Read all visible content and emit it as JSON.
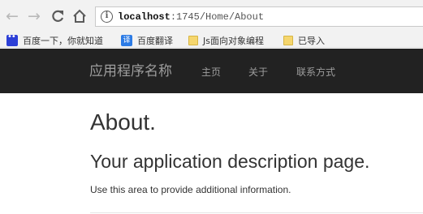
{
  "browser": {
    "url_host": "localhost",
    "url_path": ":1745/Home/About",
    "back_icon": "arrow-left-icon",
    "forward_icon": "arrow-right-icon",
    "reload_icon": "reload-icon",
    "home_icon": "home-icon",
    "info_icon": "info-icon"
  },
  "bookmarks": [
    {
      "label": "百度一下，你就知道",
      "icon": "baidu-paw-icon"
    },
    {
      "label": "百度翻译",
      "icon": "translate-icon",
      "icon_glyph": "译"
    },
    {
      "label": "Js面向对象编程",
      "icon": "folder-icon"
    },
    {
      "label": "已导入",
      "icon": "folder-icon"
    }
  ],
  "navbar": {
    "brand": "应用程序名称",
    "links": [
      "主页",
      "关于",
      "联系方式"
    ],
    "background": "#222222",
    "link_color": "#9d9d9d"
  },
  "main": {
    "title": "About.",
    "subtitle": "Your application description page.",
    "body": "Use this area to provide additional information."
  }
}
